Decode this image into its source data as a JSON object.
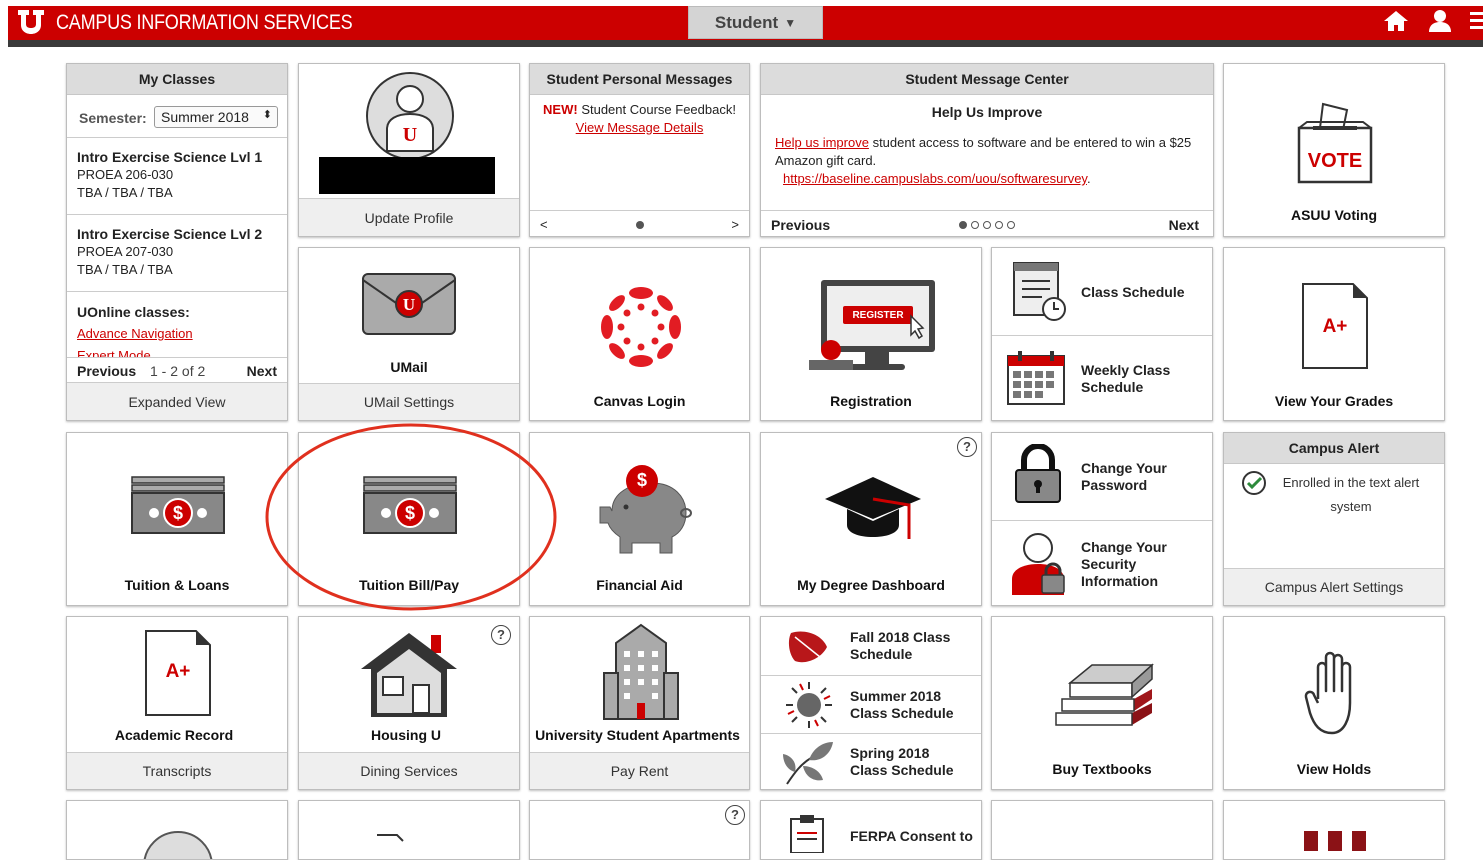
{
  "header": {
    "app_title": "CAMPUS INFORMATION SERVICES",
    "role_selector": "Student",
    "colors": {
      "brand": "#cc0000",
      "bar": "#3a3a3a"
    }
  },
  "my_classes": {
    "title": "My Classes",
    "semester_label": "Semester:",
    "semester_value": "Summer 2018",
    "classes": [
      {
        "name": "Intro Exercise Science Lvl 1",
        "code": "PROEA 206-030",
        "schedule": "TBA / TBA / TBA"
      },
      {
        "name": "Intro Exercise Science Lvl 2",
        "code": "PROEA 207-030",
        "schedule": "TBA / TBA / TBA"
      }
    ],
    "uonline_title": "UOnline classes:",
    "uonline_links": [
      "Advance Navigation",
      "Expert Mode"
    ],
    "prev": "Previous",
    "page": "1 - 2 of 2",
    "next": "Next",
    "footer": "Expanded View"
  },
  "profile": {
    "footer": "Update Profile"
  },
  "personal_messages": {
    "title": "Student Personal Messages",
    "new_badge": "NEW!",
    "text": "Student Course Feedback!",
    "link": "View Message Details",
    "prev": "<",
    "next": ">"
  },
  "message_center": {
    "title": "Student Message Center",
    "heading": "Help Us Improve",
    "link1": "Help us improve",
    "text": "student access to software and be entered to win a $25 Amazon gift card.",
    "url": "https://baseline.campuslabs.com/uou/softwaresurvey",
    "url_suffix": ".",
    "prev": "Previous",
    "next": "Next"
  },
  "voting": {
    "icon_text": "VOTE",
    "label": "ASUU Voting"
  },
  "umail": {
    "label": "UMail",
    "footer": "UMail Settings"
  },
  "canvas": {
    "label": "Canvas Login"
  },
  "registration": {
    "icon_text": "REGISTER",
    "label": "Registration"
  },
  "schedule": {
    "class_schedule": "Class Schedule",
    "weekly": "Weekly Class Schedule"
  },
  "grades": {
    "icon_text": "A+",
    "label": "View Your Grades"
  },
  "tuition_loans": {
    "label": "Tuition & Loans"
  },
  "tuition_bill": {
    "label": "Tuition Bill/Pay"
  },
  "financial_aid": {
    "label": "Financial Aid"
  },
  "degree": {
    "label": "My Degree Dashboard"
  },
  "security": {
    "password": "Change Your Password",
    "security_info": "Change Your Security Information"
  },
  "campus_alert": {
    "title": "Campus Alert",
    "text": "Enrolled in the text alert system",
    "footer": "Campus Alert Settings"
  },
  "academic": {
    "icon_text": "A+",
    "label": "Academic Record",
    "footer": "Transcripts"
  },
  "housing": {
    "label": "Housing U",
    "footer": "Dining Services"
  },
  "apartments": {
    "label": "University Student Apartments",
    "footer": "Pay Rent"
  },
  "semester_schedules": {
    "fall": "Fall 2018 Class Schedule",
    "summer": "Summer 2018 Class Schedule",
    "spring": "Spring 2018 Class Schedule"
  },
  "textbooks": {
    "label": "Buy Textbooks"
  },
  "holds": {
    "label": "View Holds"
  },
  "ferpa": {
    "label": "FERPA Consent to"
  },
  "help_icon": "?",
  "dollar": "$"
}
